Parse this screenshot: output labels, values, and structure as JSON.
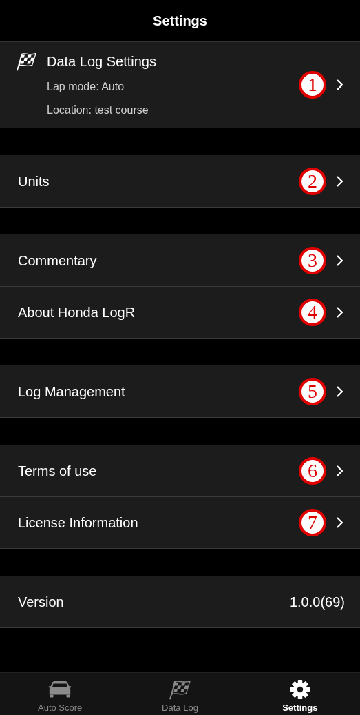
{
  "header": {
    "title": "Settings"
  },
  "groups": [
    {
      "rows": [
        {
          "kind": "detail",
          "label": "Data Log Settings",
          "lines": [
            "Lap mode: Auto",
            "Location: test course"
          ],
          "marker": "1"
        }
      ]
    },
    {
      "rows": [
        {
          "kind": "link",
          "label": "Units",
          "marker": "2"
        }
      ]
    },
    {
      "rows": [
        {
          "kind": "link",
          "label": "Commentary",
          "marker": "3"
        },
        {
          "kind": "link",
          "label": "About Honda LogR",
          "marker": "4"
        }
      ]
    },
    {
      "rows": [
        {
          "kind": "link",
          "label": "Log Management",
          "marker": "5"
        }
      ]
    },
    {
      "rows": [
        {
          "kind": "link",
          "label": "Terms of use",
          "marker": "6"
        },
        {
          "kind": "link",
          "label": "License Information",
          "marker": "7"
        }
      ]
    },
    {
      "rows": [
        {
          "kind": "value",
          "label": "Version",
          "value": "1.0.0(69)"
        }
      ]
    }
  ],
  "tab_bar": [
    {
      "kind": "car",
      "label": "Auto Score",
      "selected": false
    },
    {
      "kind": "flag",
      "label": "Data Log",
      "selected": false
    },
    {
      "kind": "gear",
      "label": "Settings",
      "selected": true
    }
  ]
}
